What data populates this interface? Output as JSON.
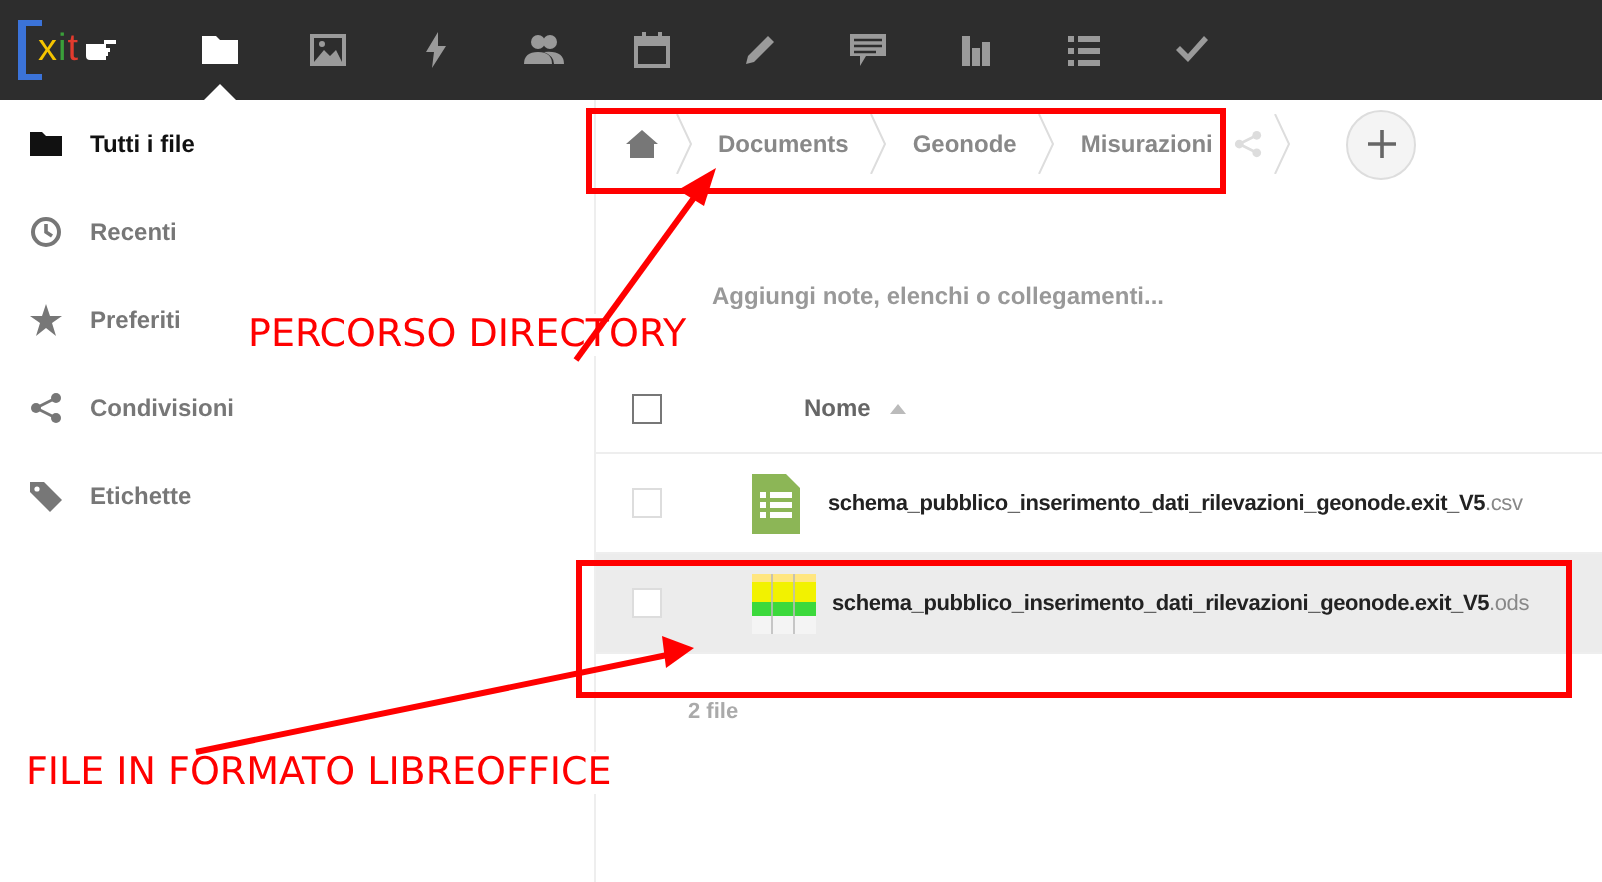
{
  "logo": {
    "text": "xit"
  },
  "nav": [
    {
      "selected": true
    },
    {
      "selected": false
    },
    {
      "selected": false
    },
    {
      "selected": false
    },
    {
      "selected": false
    },
    {
      "selected": false
    },
    {
      "selected": false
    },
    {
      "selected": false
    },
    {
      "selected": false
    },
    {
      "selected": false
    }
  ],
  "sidebar": {
    "items": [
      {
        "label": "Tutti i file",
        "selected": true
      },
      {
        "label": "Recenti",
        "selected": false
      },
      {
        "label": "Preferiti",
        "selected": false
      },
      {
        "label": "Condivisioni",
        "selected": false
      },
      {
        "label": "Etichette",
        "selected": false
      }
    ]
  },
  "breadcrumb": [
    "Documents",
    "Geonode",
    "Misurazioni"
  ],
  "notes": {
    "placeholder": "Aggiungi note, elenchi o collegamenti..."
  },
  "table": {
    "columns": [
      "Nome"
    ],
    "select_all": {
      "checked": false
    },
    "rows": [
      {
        "name": "schema_pubblico_inserimento_dati_rilevazioni_geonode.exit_V5",
        "extension": ".csv",
        "kind": "icon",
        "checked": false,
        "selected": false
      },
      {
        "name": "schema_pubblico_inserimento_dati_rilevazioni_geonode.exit_V5",
        "extension": ".ods",
        "kind": "thumbnail",
        "checked": false,
        "selected": true
      }
    ],
    "summary": "2 file"
  },
  "annotations": [
    "PERCORSO DIRECTORY",
    "FILE IN FORMATO LIBREOFFICE"
  ]
}
